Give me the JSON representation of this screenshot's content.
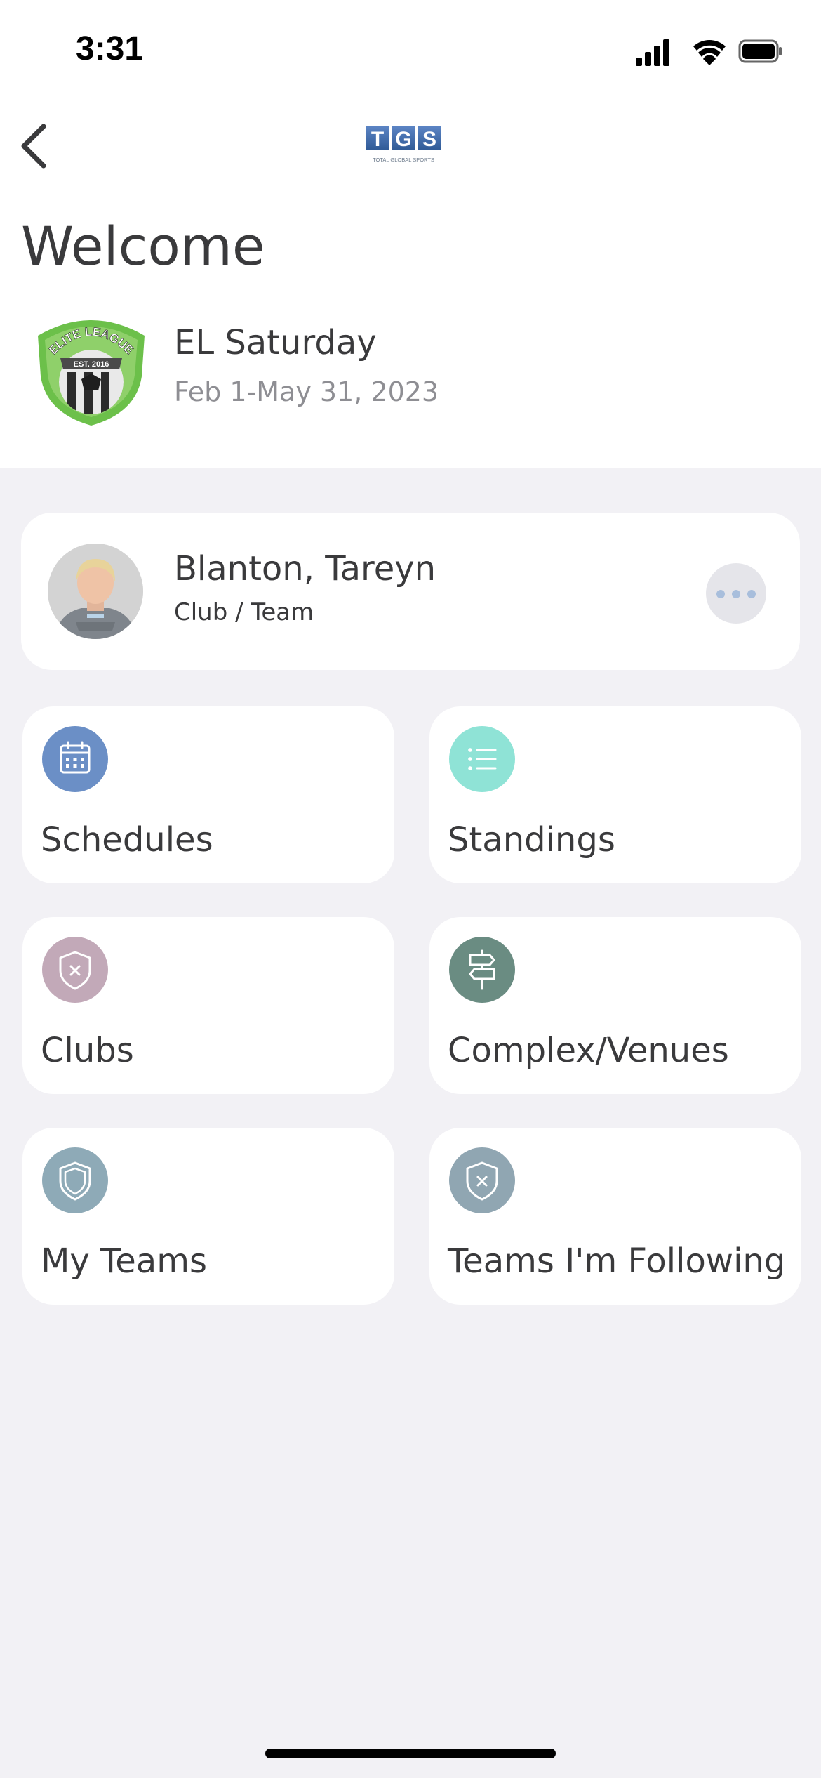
{
  "status_bar": {
    "time": "3:31"
  },
  "header": {
    "logo_letters": [
      "T",
      "G",
      "S"
    ],
    "logo_caption": "TOTAL GLOBAL SPORTS"
  },
  "page": {
    "title": "Welcome"
  },
  "event": {
    "name": "EL Saturday",
    "dates": "Feb 1-May 31, 2023",
    "logo_text_top": "ELITE LEAGUE",
    "logo_text_est": "EST. 2016"
  },
  "profile": {
    "name": "Blanton, Tareyn",
    "role": "Club / Team"
  },
  "menu": [
    {
      "label": "Schedules",
      "icon": "calendar-icon",
      "color": "#6b8fc6"
    },
    {
      "label": "Standings",
      "icon": "list-icon",
      "color": "#8fe3d6"
    },
    {
      "label": "Clubs",
      "icon": "shield-x-icon",
      "color": "#c2a9b8"
    },
    {
      "label": "Complex/Venues",
      "icon": "signpost-icon",
      "color": "#6a8c82"
    },
    {
      "label": "My Teams",
      "icon": "shield-icon",
      "color": "#8eaab7"
    },
    {
      "label": "Teams I'm Following",
      "icon": "shield-x-icon",
      "color": "#90a6b2"
    }
  ]
}
